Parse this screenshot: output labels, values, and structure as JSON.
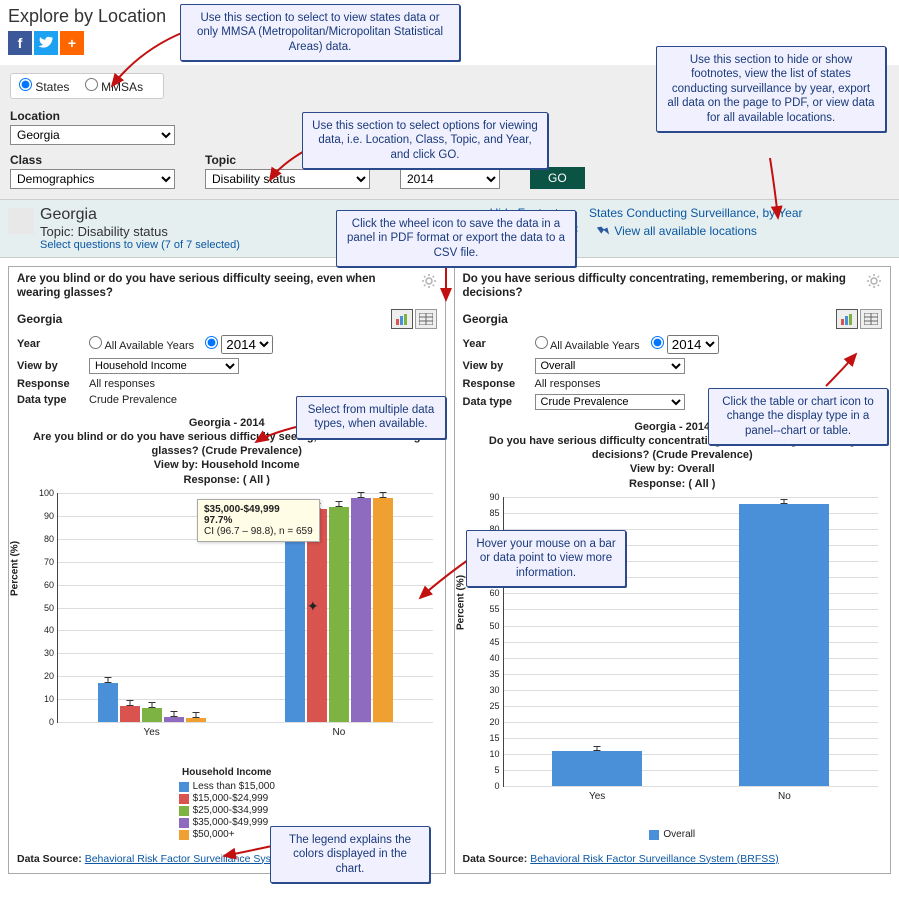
{
  "header": {
    "title": "Explore by Location"
  },
  "scope": {
    "states_label": "States",
    "mmsas_label": "MMSAs",
    "states_checked": true
  },
  "filters": {
    "location_label": "Location",
    "location_value": "Georgia",
    "class_label": "Class",
    "class_value": "Demographics",
    "topic_label": "Topic",
    "topic_value": "Disability status",
    "year_label": "Year",
    "year_value": "2014",
    "go_label": "GO"
  },
  "context": {
    "state": "Georgia",
    "topic_line": "Topic: Disability status",
    "select_questions": "Select questions to view (7 of 7 selected)",
    "hide_footnotes": "Hide Footnotes",
    "save_pdf": "Save as PDF",
    "surveillance_link": "States Conducting Surveillance, by Year",
    "view_all_locations": "View all available locations"
  },
  "panels": [
    {
      "question": "Are you blind or do you have serious difficulty seeing, even when wearing glasses?",
      "state": "Georgia",
      "year_label": "Year",
      "all_years_label": "All Available Years",
      "year_sel": "2014",
      "viewby_label": "View by",
      "viewby_value": "Household Income",
      "response_label": "Response",
      "response_value": "All responses",
      "datatype_label": "Data type",
      "datatype_value": "Crude Prevalence",
      "chart_header1": "Georgia - 2014",
      "chart_header2": "Are you blind or do you have serious difficulty seeing, even when wearing glasses? (Crude Prevalence)",
      "chart_header3": "View by: Household Income",
      "chart_header4": "Response: ( All )",
      "yaxis": "Percent (%)",
      "x_categories": [
        "Yes",
        "No"
      ],
      "legend_title": "Household Income",
      "legend_items": [
        "Less than $15,000",
        "$15,000-$24,999",
        "$25,000-$34,999",
        "$35,000-$49,999",
        "$50,000+"
      ],
      "datasource_label": "Data Source:",
      "datasource_link": "Behavioral Risk Factor Surveillance System (BRFSS)",
      "tooltip": {
        "title": "$35,000-$49,999",
        "value": "97.7%",
        "ci": "CI (96.7 – 98.8), n = 659"
      }
    },
    {
      "question": "Do you have serious difficulty concentrating, remembering, or making decisions?",
      "state": "Georgia",
      "year_label": "Year",
      "all_years_label": "All Available Years",
      "year_sel": "2014",
      "viewby_label": "View by",
      "viewby_value": "Overall",
      "response_label": "Response",
      "response_value": "All responses",
      "datatype_label": "Data type",
      "datatype_value": "Crude Prevalence",
      "chart_header1": "Georgia - 2014",
      "chart_header2": "Do you have serious difficulty concentrating, remembering, or making decisions? (Crude Prevalence)",
      "chart_header3": "View by: Overall",
      "chart_header4": "Response: ( All )",
      "yaxis": "Percent (%)",
      "x_categories": [
        "Yes",
        "No"
      ],
      "legend_items": [
        "Overall"
      ],
      "datasource_label": "Data Source:",
      "datasource_link": "Behavioral Risk Factor Surveillance System (BRFSS)"
    }
  ],
  "callouts": {
    "scope": "Use this section to select to view states data or only MMSA (Metropolitan/Micropolitan Statistical Areas) data.",
    "filters": "Use this section to select options for viewing data, i.e. Location, Class, Topic, and Year, and click GO.",
    "ctx_right": "Use this section to hide or show footnotes, view the list of states conducting surveillance by year, export all data on the page to PDF, or view data for all available locations.",
    "wheel": "Click the wheel icon to save the data in a panel in PDF format or export the data to a CSV file.",
    "datatypes": "Select from multiple data types, when available.",
    "toggle": "Click the table or chart icon to change the display type in a panel--chart or table.",
    "hover": "Hover your mouse on a bar or data point to view more information.",
    "legend": "The legend explains the colors displayed in the chart."
  },
  "chart_data": [
    {
      "type": "bar",
      "title": "Georgia - 2014 — Are you blind or do you have serious difficulty seeing, even when wearing glasses? (Crude Prevalence), View by: Household Income, Response: (All)",
      "xlabel": "",
      "ylabel": "Percent (%)",
      "ylim": [
        0,
        100
      ],
      "categories": [
        "Yes",
        "No"
      ],
      "series": [
        {
          "name": "Less than $15,000",
          "values": [
            17,
            83
          ],
          "color": "#4a90d9"
        },
        {
          "name": "$15,000-$24,999",
          "values": [
            7,
            93
          ],
          "color": "#d9534f"
        },
        {
          "name": "$25,000-$34,999",
          "values": [
            6,
            94
          ],
          "color": "#7cb342"
        },
        {
          "name": "$35,000-$49,999",
          "values": [
            2.3,
            97.7
          ],
          "color": "#8e6bbf"
        },
        {
          "name": "$50,000+",
          "values": [
            2,
            98
          ],
          "color": "#f0a030"
        }
      ]
    },
    {
      "type": "bar",
      "title": "Georgia - 2014 — Do you have serious difficulty concentrating, remembering, or making decisions? (Crude Prevalence), View by: Overall, Response: (All)",
      "xlabel": "",
      "ylabel": "Percent (%)",
      "ylim": [
        0,
        90
      ],
      "categories": [
        "Yes",
        "No"
      ],
      "series": [
        {
          "name": "Overall",
          "values": [
            11,
            88
          ],
          "color": "#4a90d9"
        }
      ]
    }
  ]
}
